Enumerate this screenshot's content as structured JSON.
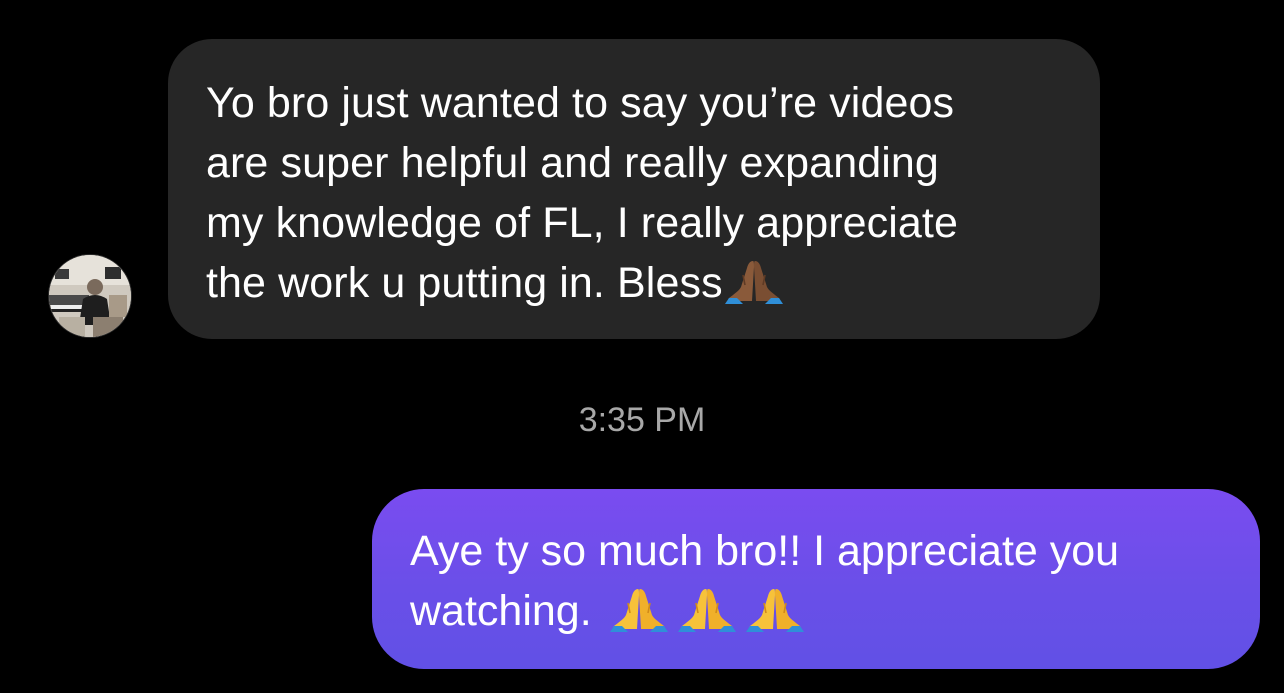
{
  "thread": {
    "incoming": {
      "lines": [
        "Yo bro just wanted to say you’re videos",
        "are super helpful and really expanding",
        "my knowledge of FL, I really appreciate",
        "the work u putting in. Bless"
      ],
      "emoji": "folded-hands-medium-dark"
    },
    "timestamp": "3:35 PM",
    "outgoing": {
      "lines": [
        "Aye ty so much bro!! I appreciate you",
        "watching. "
      ],
      "emoji": [
        "folded-hands",
        "folded-hands",
        "folded-hands"
      ]
    }
  },
  "colors": {
    "background": "#000000",
    "incoming_bubble": "#262626",
    "outgoing_bubble": "#6a4fe8",
    "timestamp_text": "#a8a8a8",
    "message_text": "#ffffff"
  }
}
